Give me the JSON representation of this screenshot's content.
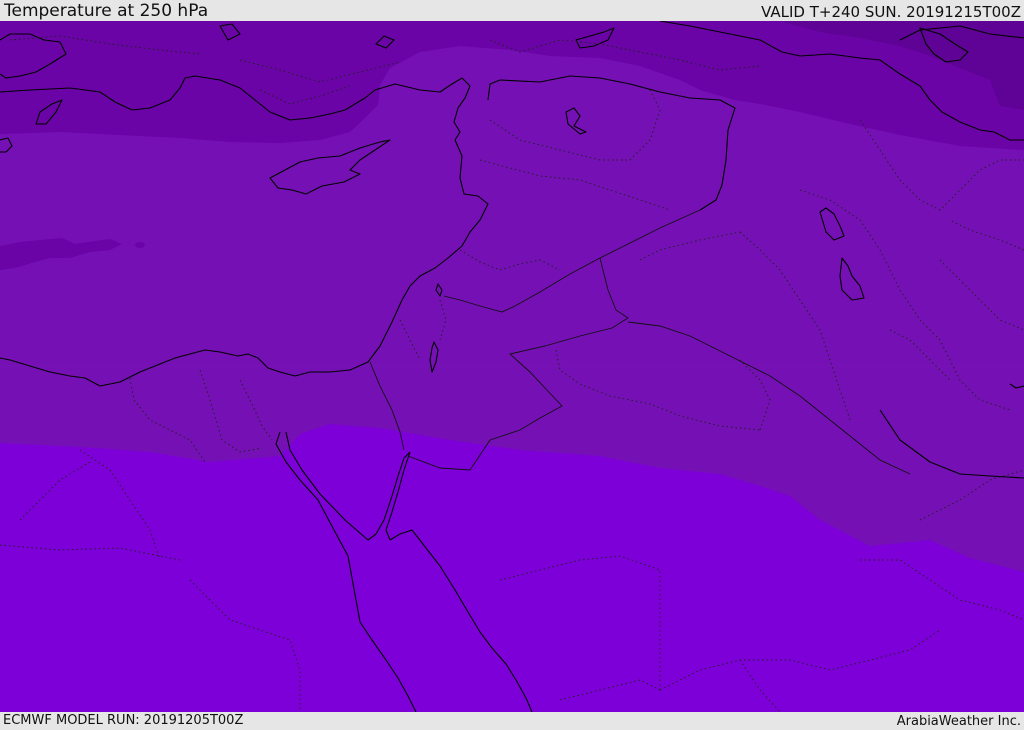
{
  "header": {
    "title": "Temperature at 250 hPa",
    "valid": "VALID T+240 SUN. 20191215T00Z"
  },
  "footer": {
    "model_run": "ECMWF MODEL RUN: 20191205T00Z",
    "credit": "ArabiaWeather Inc."
  },
  "colors": {
    "coldest_band": "#5f0296",
    "cold_band": "#6a04a6",
    "mid_band": "#7510b5",
    "warm_band": "#7d00d8",
    "coastline": "#000000",
    "borders": "#111111"
  }
}
